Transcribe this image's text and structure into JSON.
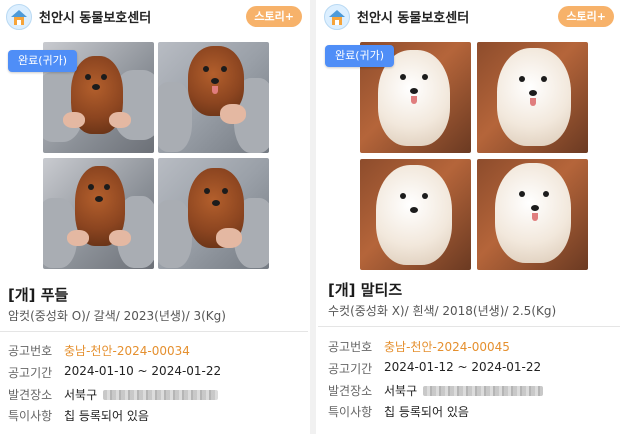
{
  "cards": [
    {
      "org_name": "천안시 동물보호센터",
      "story_label": "스토리+",
      "badge": "완료(귀가)",
      "title": "[개] 푸들",
      "subtitle": "암컷(중성화 O)/ 갈색/ 2023(년생)/ 3(Kg)",
      "info": [
        {
          "label": "공고번호",
          "value": "충남-천안-2024-00034"
        },
        {
          "label": "공고기간",
          "value": "2024-01-10 ~ 2024-01-22"
        },
        {
          "label": "발견장소",
          "value": "서북구"
        },
        {
          "label": "특이사항",
          "value": "칩 등록되어 있음"
        }
      ]
    },
    {
      "org_name": "천안시 동물보호센터",
      "story_label": "스토리+",
      "badge": "완료(귀가)",
      "title": "[개] 말티즈",
      "subtitle": "수컷(중성화 X)/ 흰색/ 2018(년생)/ 2.5(Kg)",
      "info": [
        {
          "label": "공고번호",
          "value": "충남-천안-2024-00045"
        },
        {
          "label": "공고기간",
          "value": "2024-01-12 ~ 2024-01-22"
        },
        {
          "label": "발견장소",
          "value": "서북구"
        },
        {
          "label": "특이사항",
          "value": "칩 등록되어 있음"
        }
      ]
    }
  ],
  "colors": {
    "badge": "#4f8ef7",
    "story_button": "#f7b26a",
    "accent_notice": "#e5902f"
  },
  "icons": {
    "logo": "shelter-house-icon"
  }
}
